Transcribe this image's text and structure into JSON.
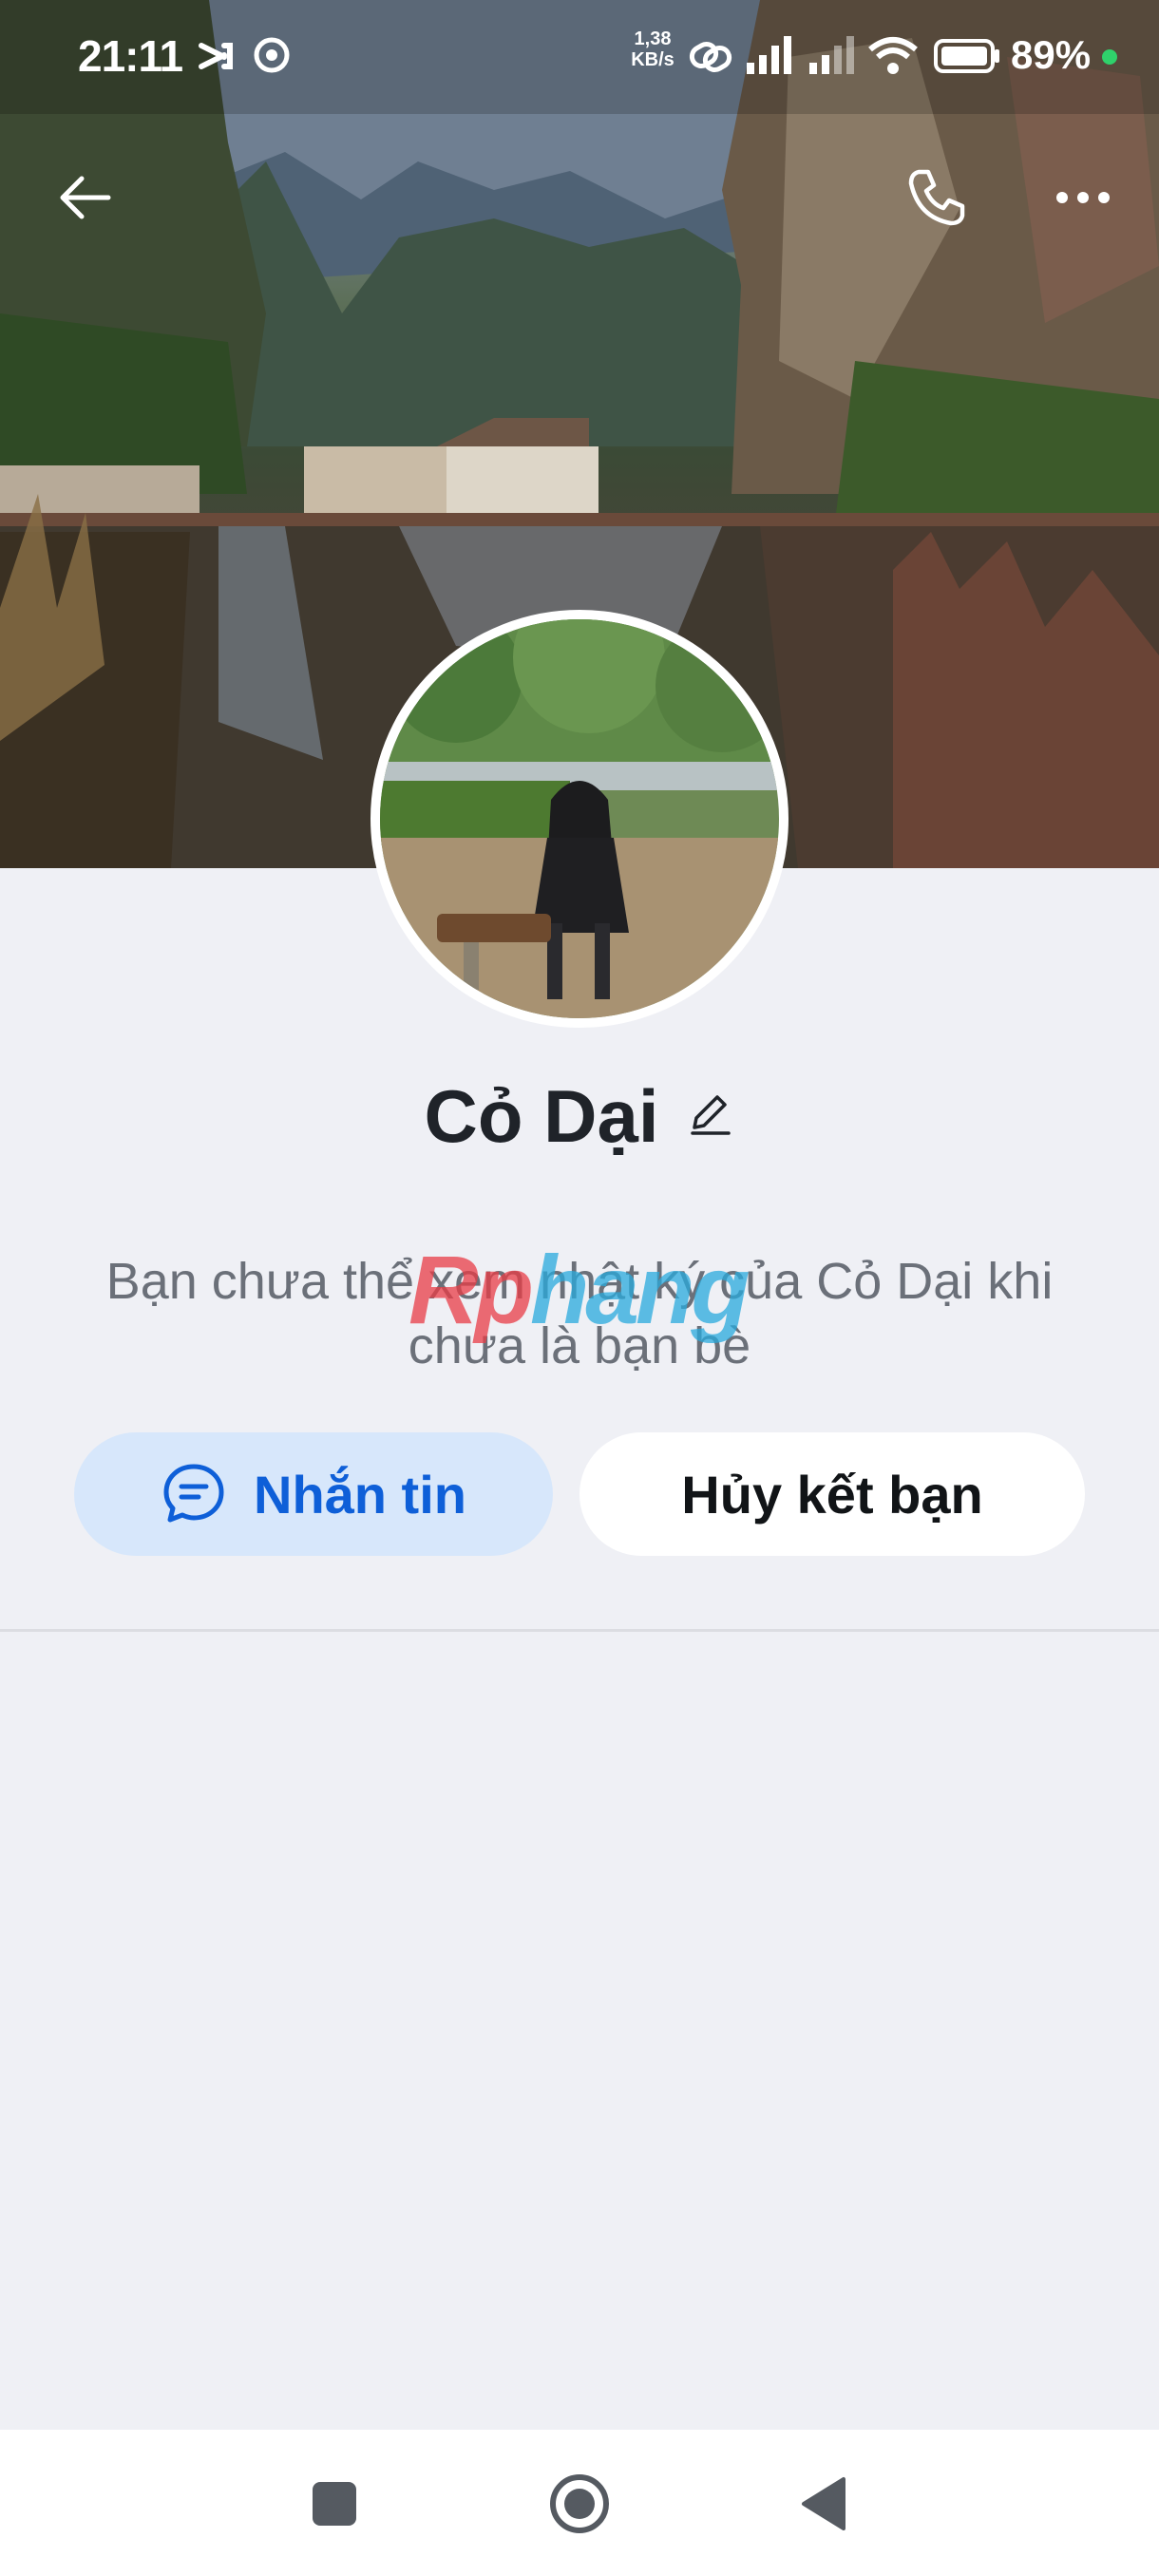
{
  "status_bar": {
    "time": "21:11",
    "net_speed_value": "1,38",
    "net_speed_unit": "KB/s",
    "battery_percent": "89%",
    "icons": [
      "capcut-icon",
      "chrome-icon",
      "link-icon",
      "signal-icon",
      "signal-icon",
      "wifi-icon",
      "battery-icon"
    ]
  },
  "toolbar": {
    "back_icon": "back-arrow-icon",
    "call_icon": "phone-icon",
    "more_icon": "more-icon"
  },
  "profile": {
    "name": "Cỏ Dại",
    "edit_icon": "pencil-icon"
  },
  "notice": {
    "text": "Bạn chưa thể xem nhật ký của Cỏ Dại khi chưa là bạn bè"
  },
  "watermark": {
    "part1": "Rp",
    "part2": "hang"
  },
  "actions": {
    "message_label": "Nhắn tin",
    "unfriend_label": "Hủy kết bạn"
  },
  "nav_bar": {
    "icons": [
      "recents-icon",
      "home-icon",
      "back-icon"
    ]
  },
  "colors": {
    "accent": "#0e5fd8",
    "message_button_bg": "#d7e7fb",
    "page_bg": "#eff0f5",
    "charging_dot": "#2fd16b"
  }
}
